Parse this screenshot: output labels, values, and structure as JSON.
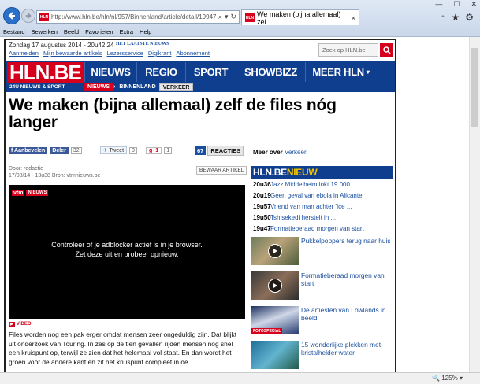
{
  "browser": {
    "url": "http://www.hln.be/hln/nl/957/Binnenland/article/detail/1994783/",
    "favicon_text": "HLN",
    "tab_title": "We maken (bijna allemaal) zel...",
    "tab_close": "×",
    "menu": [
      "Bestand",
      "Bewerken",
      "Beeld",
      "Favorieten",
      "Extra",
      "Help"
    ],
    "zoom": "125%"
  },
  "site": {
    "date": "Zondag 17 augustus 2014 - 20u42:24",
    "top_links": [
      "Aanmelden",
      "Mijn bewaarde artikels",
      "Lezersservice",
      "Digikrant",
      "Abonnement"
    ],
    "small_logo": "HET LAATSTE NIEUWS",
    "search_placeholder": "Zoek op HLN.be",
    "logo": "HLN.BE",
    "logo_sub": "24U NIEUWS & SPORT",
    "nav": [
      "NIEUWS",
      "REGIO",
      "SPORT",
      "SHOWBIZZ",
      "MEER HLN"
    ],
    "breadcrumb": [
      "NIEUWS",
      "BINNENLAND",
      "VERKEER"
    ]
  },
  "article": {
    "headline": "We maken (bijna allemaal) zelf de files nóg langer",
    "social": {
      "fb_like": "Aanbevelen",
      "fb_share": "Deler",
      "fb_count": "32",
      "tweet": "Tweet",
      "tweet_count": "0",
      "gplus": "g+1",
      "gplus_count": "1"
    },
    "reactions_count": "67",
    "reactions_label": "REACTIES",
    "author": "Door: redactie",
    "timeline": "17/08/14 - 13u38  Bron: vtmnieuws.be",
    "save_button": "BEWAAR ARTIKEL",
    "video_brand": "vtm",
    "video_brand_badge": "NIEUWS",
    "video_message_line1": "Controleer of je adblocker actief is in je browser.",
    "video_message_line2": "Zet deze uit en probeer opnieuw.",
    "video_label": "VIDEO",
    "body": "Files worden nog een pak erger omdat mensen zeer ongeduldig zijn. Dat blijkt uit onderzoek van Touring. In zes op de tien gevallen rijden mensen nog snel een kruispunt op, terwijl ze zien dat het helemaal vol staat. En dan wordt het groen voor de andere kant en zit het kruispunt compleet in de"
  },
  "sidebar": {
    "meer_over_label": "Meer over",
    "meer_over_link": "Verkeer",
    "nieuws_title_a": "HLN.BE",
    "nieuws_title_b": "NIEUW",
    "headlines": [
      {
        "time": "20u36",
        "title": "Jazz Middelheim lokt 19.000 ..."
      },
      {
        "time": "20u19",
        "title": "Geen geval van ebola in Alicante"
      },
      {
        "time": "19u57",
        "title": "Vriend van man achter 'Ice ..."
      },
      {
        "time": "19u50",
        "title": "Tshisekedi herstelt in ..."
      },
      {
        "time": "19u47",
        "title": "Formatieberaad morgen van start"
      }
    ],
    "image_items": [
      {
        "caption": "Pukkelpoppers terug naar huis",
        "video": true
      },
      {
        "caption": "Formatieberaad morgen van start",
        "video": true
      },
      {
        "caption": "De artiesten van Lowlands in beeld",
        "badge": "FOTOSPECIAL"
      },
      {
        "caption": "15 wonderlijke plekken met kristalhelder water"
      }
    ]
  }
}
